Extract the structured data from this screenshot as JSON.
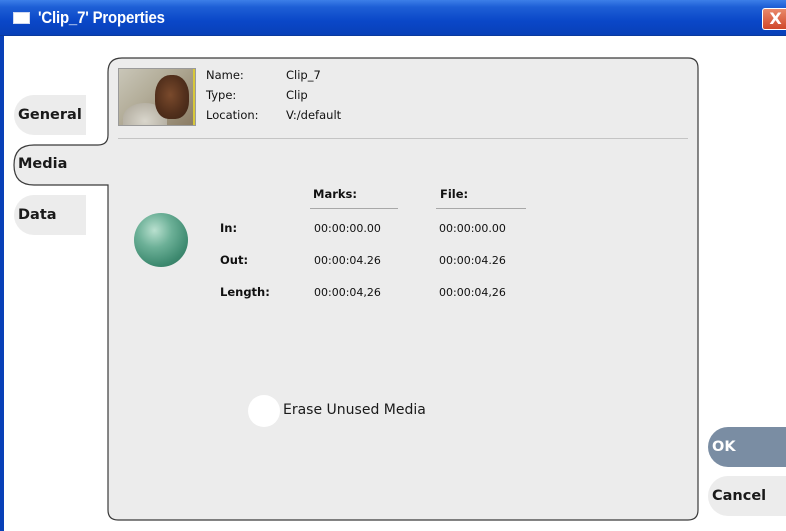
{
  "window": {
    "title": "'Clip_7' Properties",
    "close_glyph": "X"
  },
  "tabs": [
    {
      "label": "General",
      "active": false
    },
    {
      "label": "Media",
      "active": true
    },
    {
      "label": "Data",
      "active": false
    }
  ],
  "clip": {
    "name_label": "Name:",
    "name_value": "Clip_7",
    "type_label": "Type:",
    "type_value": "Clip",
    "location_label": "Location:",
    "location_value": "V:/default"
  },
  "timecodes": {
    "headers": {
      "marks": "Marks:",
      "file": "File:"
    },
    "rows": [
      {
        "label": "In:",
        "marks": "00:00:00.00",
        "file": "00:00:00.00"
      },
      {
        "label": "Out:",
        "marks": "00:00:04.26",
        "file": "00:00:04.26"
      },
      {
        "label": "Length:",
        "marks": "00:00:04,26",
        "file": "00:00:04,26"
      }
    ]
  },
  "erase": {
    "label": "Erase Unused Media",
    "checked": false
  },
  "buttons": {
    "ok": "OK",
    "cancel": "Cancel"
  },
  "colors": {
    "titlebar": "#0840b8",
    "panel": "#ececec",
    "ok_button": "#7a8da3",
    "sphere": "#3e8a70"
  },
  "icons": {
    "window": "window-icon",
    "close": "close-icon",
    "status": "status-sphere-icon"
  }
}
